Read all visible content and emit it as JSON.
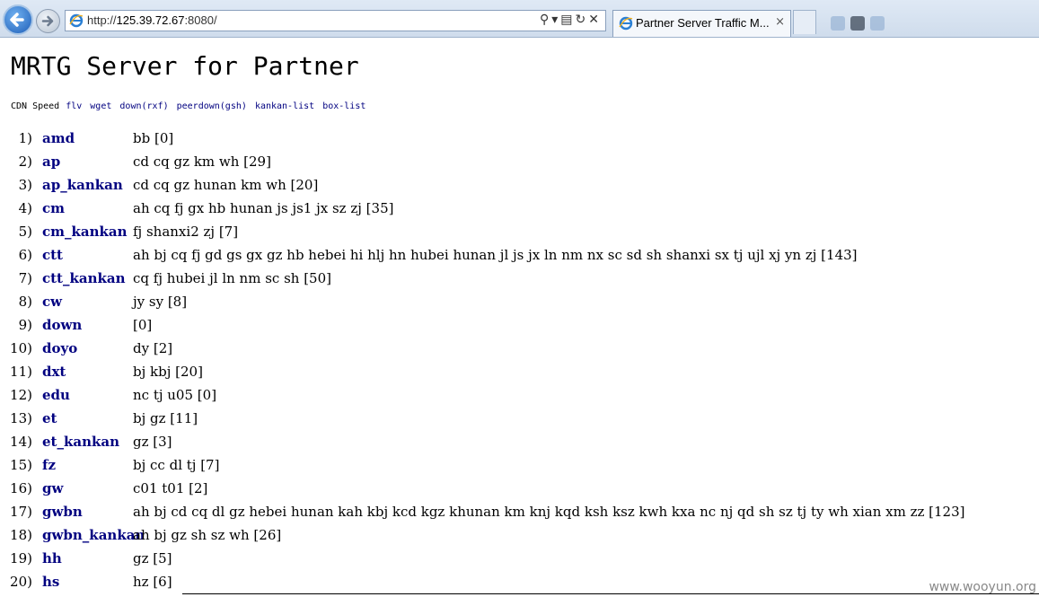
{
  "browser": {
    "url_prefix": "http://",
    "url_host": "125.39.72.67",
    "url_suffix": ":8080/",
    "tab_title": "Partner Server Traffic M...",
    "tab_close": "×"
  },
  "page": {
    "title": "MRTG Server for Partner",
    "nav_label": "CDN Speed",
    "nav_links": [
      "flv",
      "wget",
      "down(rxf)",
      "peerdown(gsh)",
      "kankan-list",
      "box-list"
    ]
  },
  "servers": [
    {
      "num": "1)",
      "name": "amd",
      "hosts": "bb [0]"
    },
    {
      "num": "2)",
      "name": "ap",
      "hosts": "cd cq gz km wh [29]"
    },
    {
      "num": "3)",
      "name": "ap_kankan",
      "hosts": "cd cq gz hunan km wh [20]"
    },
    {
      "num": "4)",
      "name": "cm",
      "hosts": "ah cq fj gx hb hunan js js1 jx sz zj [35]"
    },
    {
      "num": "5)",
      "name": "cm_kankan",
      "hosts": "fj shanxi2 zj [7]"
    },
    {
      "num": "6)",
      "name": "ctt",
      "hosts": "ah bj cq fj gd gs gx gz hb hebei hi hlj hn hubei hunan jl js jx ln nm nx sc sd sh shanxi sx tj ujl xj yn zj [143]"
    },
    {
      "num": "7)",
      "name": "ctt_kankan",
      "hosts": "cq fj hubei jl ln nm sc sh [50]"
    },
    {
      "num": "8)",
      "name": "cw",
      "hosts": "jy sy [8]"
    },
    {
      "num": "9)",
      "name": "down",
      "hosts": "[0]"
    },
    {
      "num": "10)",
      "name": "doyo",
      "hosts": "dy [2]"
    },
    {
      "num": "11)",
      "name": "dxt",
      "hosts": "bj kbj [20]"
    },
    {
      "num": "12)",
      "name": "edu",
      "hosts": "nc tj u05 [0]"
    },
    {
      "num": "13)",
      "name": "et",
      "hosts": "bj gz [11]"
    },
    {
      "num": "14)",
      "name": "et_kankan",
      "hosts": "gz [3]"
    },
    {
      "num": "15)",
      "name": "fz",
      "hosts": "bj cc dl tj [7]"
    },
    {
      "num": "16)",
      "name": "gw",
      "hosts": "c01 t01 [2]"
    },
    {
      "num": "17)",
      "name": "gwbn",
      "hosts": "ah bj cd cq dl gz hebei hunan kah kbj kcd kgz khunan km knj kqd ksh ksz kwh kxa nc nj qd sh sz tj ty wh xian xm zz [123]"
    },
    {
      "num": "18)",
      "name": "gwbn_kankan",
      "hosts": "ah bj gz sh sz wh [26]"
    },
    {
      "num": "19)",
      "name": "hh",
      "hosts": "gz [5]"
    },
    {
      "num": "20)",
      "name": "hs",
      "hosts": "hz [6]"
    }
  ],
  "watermark": "www.wooyun.org",
  "colors": {
    "link": "#000080",
    "text": "#000000",
    "background": "#ffffff"
  }
}
